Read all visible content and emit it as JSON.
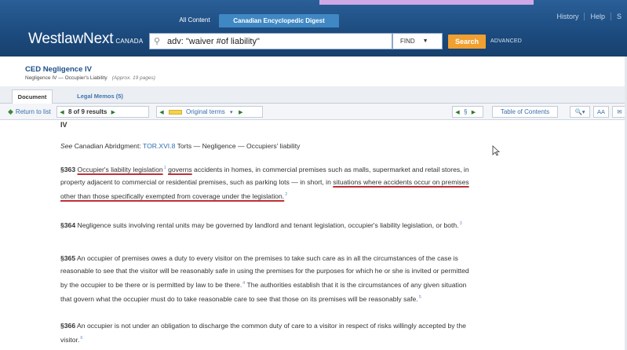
{
  "header": {
    "tabs": {
      "all_content": "All Content",
      "ced": "Canadian Encyclopedic Digest"
    },
    "logo": {
      "main": "WestlawNext",
      "suffix": "CANADA"
    },
    "search_query": "adv: \"waiver #of liability\"",
    "find_label": "FIND",
    "search_button": "Search",
    "advanced_link": "ADVANCED",
    "top_links": [
      "History",
      "Help",
      "S"
    ]
  },
  "document": {
    "title": "CED Negligence IV",
    "subtitle": "Negligence    IV — Occupier's Liability",
    "pages": "(Approx. 19 pages)"
  },
  "doc_tabs": {
    "document": "Document",
    "legal_memos": "Legal Memos (5)"
  },
  "toolbar": {
    "return": "Return to list",
    "results_of": "8 of 9 results",
    "original_terms": "Original terms",
    "section_symbol": "§",
    "toc": "Table of Contents",
    "zoom_label": "AA"
  },
  "body": {
    "roman": "IV",
    "see_prefix": "See",
    "see_text": "Canadian Abridgment:",
    "see_link": "TOR.XVI.8",
    "see_rest": "Torts — Negligence — Occupiers' liability",
    "p363": {
      "sec": "§363",
      "ul1": "Occupier's liability legislation",
      "fn1": "1",
      "ul2": "governs",
      "t1": "accidents in homes, in commercial premises such as malls, supermarket and retail stores, in property adjacent to commercial or residential premises, such as parking lots — in short, in",
      "ul3": "situations where accidents occur on premises other than those specifically exempted from coverage under the legislation.",
      "fn2": "2"
    },
    "p364": {
      "sec": "§364",
      "text": "Negligence suits involving rental units may be governed by landlord and tenant legislation, occupier's liability legislation, or both.",
      "fn": "3"
    },
    "p365": {
      "sec": "§365",
      "t1": "An occupier of premises owes a duty to every visitor on the premises to take such care as in all the circumstances of the case is reasonable to see that the visitor will be reasonably safe in using the premises for the purposes for which he or she is invited or permitted by the occupier to be there or is permitted by law to be there.",
      "fn1": "4",
      "t2": "The authorities establish that it is the circumstances of any given situation that govern what the occupier must do to take reasonable care to see that those on its premises will be reasonably safe.",
      "fn2": "5"
    },
    "p366": {
      "sec": "§366",
      "text": "An occupier is not under an obligation to discharge the common duty of care to a visitor in respect of risks willingly accepted by the visitor.",
      "fn": "6"
    }
  },
  "colors": {
    "header_blue": "#1d4c80",
    "tab_blue": "#3f88c4",
    "search_orange": "#f0a030",
    "underline_red": "#c0303a",
    "link_blue": "#2f6db0"
  }
}
